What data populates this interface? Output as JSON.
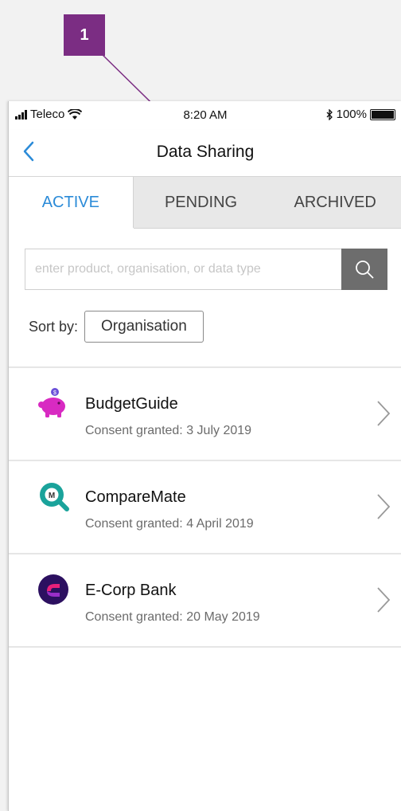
{
  "annotation": {
    "number": "1",
    "color": "#7b2d83"
  },
  "status_bar": {
    "carrier": "Teleco",
    "time": "8:20 AM",
    "battery": "100%",
    "battery_level": 1.0
  },
  "nav": {
    "title": "Data Sharing",
    "back_icon": "chevron-left-icon"
  },
  "tabs": [
    {
      "label": "ACTIVE",
      "active": true
    },
    {
      "label": "PENDING",
      "active": false
    },
    {
      "label": "ARCHIVED",
      "active": false
    }
  ],
  "search": {
    "placeholder": "enter product, organisation, or data type",
    "value": "",
    "icon": "search-icon"
  },
  "sort": {
    "label": "Sort by:",
    "value": "Organisation"
  },
  "items": [
    {
      "name": "BudgetGuide",
      "detail": "Consent granted: 3 July 2019",
      "icon": "piggy-bank-icon"
    },
    {
      "name": "CompareMate",
      "detail": "Consent granted: 4 April 2019",
      "icon": "comparemate-logo-icon"
    },
    {
      "name": "E-Corp Bank",
      "detail": "Consent granted: 20 May 2019",
      "icon": "ecorp-logo-icon"
    }
  ],
  "colors": {
    "accent": "#2b8bd8",
    "annotation": "#7b2d83",
    "search_button": "#6d6d6d"
  }
}
